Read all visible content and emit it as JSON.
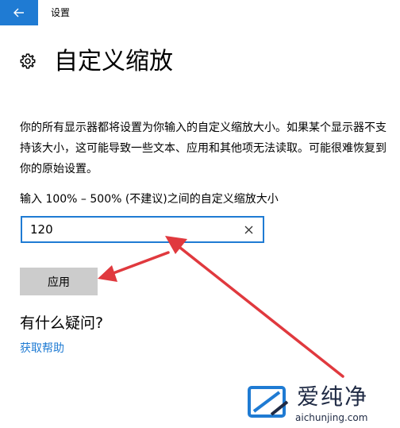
{
  "window": {
    "title": "设置"
  },
  "header": {
    "title": "自定义缩放",
    "icon": "gear-icon"
  },
  "description": "你的所有显示器都将设置为你输入的自定义缩放大小。如果某个显示器不支持该大小，这可能导致一些文本、应用和其他项无法读取。可能很难恢复到你的原始设置。",
  "scale_input": {
    "label": "输入 100% – 500% (不建议)之间的自定义缩放大小",
    "value": "120"
  },
  "apply_button": {
    "label": "应用"
  },
  "help": {
    "heading": "有什么疑问?",
    "link": "获取帮助"
  },
  "watermark": {
    "brand": "爱纯净",
    "url": "aichunjing.com"
  },
  "colors": {
    "accent": "#1f7bd3",
    "annotation_arrow": "#e0393e",
    "button_bg": "#cccccc"
  }
}
